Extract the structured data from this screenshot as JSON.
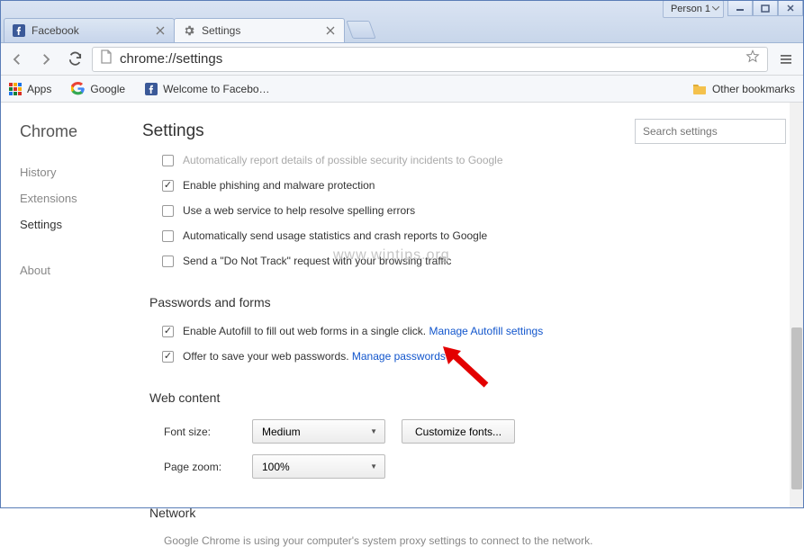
{
  "window": {
    "profile": "Person 1"
  },
  "tabs": [
    {
      "title": "Facebook",
      "active": false
    },
    {
      "title": "Settings",
      "active": true
    }
  ],
  "omnibox": {
    "url": "chrome://settings"
  },
  "bookmarks": {
    "apps": "Apps",
    "google": "Google",
    "fb": "Welcome to Facebo…",
    "other": "Other bookmarks"
  },
  "sidebar": {
    "brand": "Chrome",
    "items": [
      "History",
      "Extensions",
      "Settings",
      "About"
    ],
    "selected": 2
  },
  "page": {
    "title": "Settings",
    "search_placeholder": "Search settings"
  },
  "privacy": {
    "cut_off": "Automatically report details of possible security incidents to Google",
    "phishing": "Enable phishing and malware protection",
    "spelling": "Use a web service to help resolve spelling errors",
    "usage": "Automatically send usage statistics and crash reports to Google",
    "dnt": "Send a \"Do Not Track\" request with your browsing traffic"
  },
  "passwords": {
    "heading": "Passwords and forms",
    "autofill": "Enable Autofill to fill out web forms in a single click. ",
    "autofill_link": "Manage Autofill settings",
    "offer": "Offer to save your web passwords. ",
    "offer_link": "Manage passwords"
  },
  "web": {
    "heading": "Web content",
    "font_label": "Font size:",
    "font_value": "Medium",
    "customize": "Customize fonts...",
    "zoom_label": "Page zoom:",
    "zoom_value": "100%"
  },
  "network": {
    "heading": "Network",
    "text": "Google Chrome is using your computer's system proxy settings to connect to the network."
  },
  "watermark": "www.wintips.org"
}
